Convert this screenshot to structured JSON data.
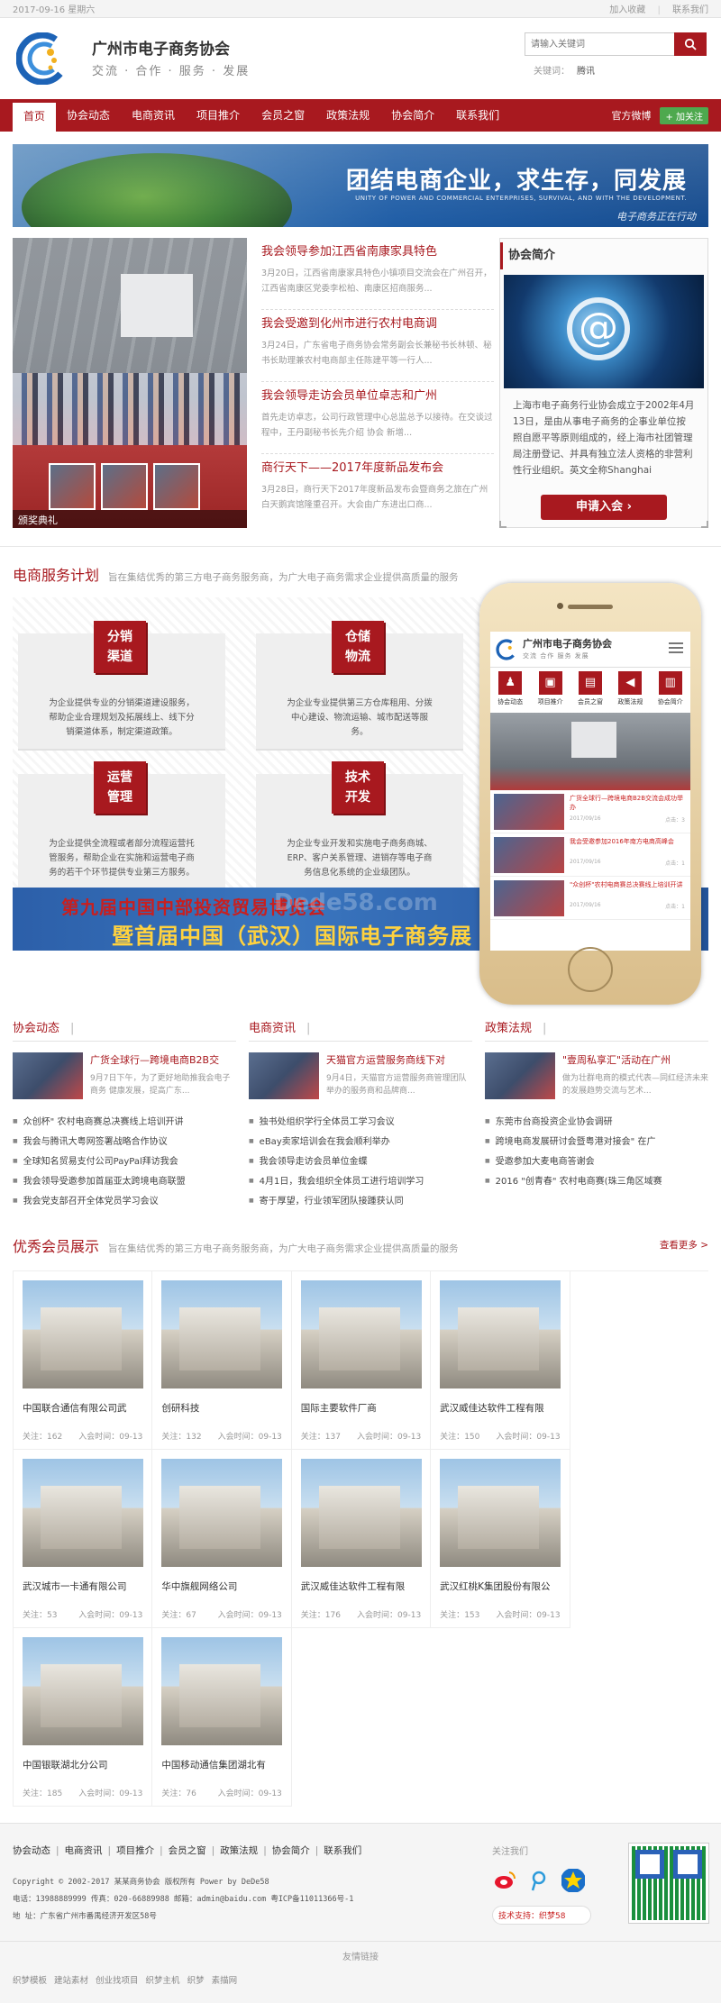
{
  "topbar": {
    "date": "2017-09-16 星期六",
    "favorite": "加入收藏",
    "contact": "联系我们"
  },
  "header": {
    "site_name": "广州市电子商务协会",
    "slogan": "交流 · 合作 · 服务 · 发展",
    "search_placeholder": "请输入关键词",
    "hot_label": "关键词：",
    "hot_word": "腾讯"
  },
  "nav": {
    "items": [
      "首页",
      "协会动态",
      "电商资讯",
      "项目推介",
      "会员之窗",
      "政策法规",
      "协会简介",
      "联系我们"
    ],
    "weibo": "官方微博",
    "follow": "+ 加关注"
  },
  "banner": {
    "title": "团结电商企业，求生存，同发展",
    "subtitle": "UNITY OF POWER AND COMMERCIAL ENTERPRISES, SURVIVAL, AND WITH THE DEVELOPMENT.",
    "tag": "电子商务正在行动"
  },
  "slide": {
    "caption": "颁奖典礼"
  },
  "news": [
    {
      "title": "我会领导参加江西省南康家具特色",
      "desc": "3月20日，江西省南康家具特色小镇项目交流会在广州召开，江西省南康区党委李松柏、南康区招商服务..."
    },
    {
      "title": "我会受邀到化州市进行农村电商调",
      "desc": "3月24日，广东省电子商务协会常务副会长兼秘书长林顿、秘书长助理兼农村电商部主任陈建平等一行人..."
    },
    {
      "title": "我会领导走访会员单位卓志和广州",
      "desc": "首先走访卓志，公司行政管理中心总监总予以接待。在交谈过程中，王丹副秘书长先介绍 协会 新增..."
    },
    {
      "title": "商行天下——2017年度新品发布会",
      "desc": "3月28日，商行天下2017年度新品发布会暨商务之旅在广州白天鹅宾馆隆重召开。大会由广东进出口商..."
    }
  ],
  "about": {
    "title": "协会简介",
    "text": "上海市电子商务行业协会成立于2002年4月13日，是由从事电子商务的企事业单位按照自愿平等原则组成的，经上海市社团管理局注册登记、并具有独立法人资格的非营利性行业组织。英文全称Shanghai Electronic Commerce A...",
    "join": "申请入会 ›"
  },
  "services": {
    "title": "电商服务计划",
    "subtitle": "旨在集结优秀的第三方电子商务服务商，为广大电子商务需求企业提供高质量的服务",
    "items": [
      {
        "badge1": "分销",
        "badge2": "渠道",
        "desc": "为企业提供专业的分销渠道建设服务，帮助企业合理规划及拓展线上、线下分销渠道体系，制定渠道政策。"
      },
      {
        "badge1": "仓储",
        "badge2": "物流",
        "desc": "为企业专业提供第三方仓库租用、分拨中心建设、物流运输、城市配送等服务。"
      },
      {
        "badge1": "运营",
        "badge2": "管理",
        "desc": "为企业提供全流程或者部分流程运营托管服务，帮助企业在实施和运营电子商务的若干个环节提供专业第三方服务。"
      },
      {
        "badge1": "技术",
        "badge2": "开发",
        "desc": "为企业专业开发和实施电子商务商城、ERP、客户关系管理、进销存等电子商务信息化系统的企业级团队。"
      }
    ]
  },
  "expo": {
    "line1": "第九届中国中部投资贸易博览会",
    "line2": "暨首届中国（武汉）国际电子商务展",
    "watermark": "Dede58.com"
  },
  "mobile": {
    "name": "广州市电子商务协会",
    "slogan": "交流 合作 服务 发展",
    "icons": [
      "协会动态",
      "项目推介",
      "会员之窗",
      "政策法规",
      "协会简介"
    ],
    "news": [
      {
        "title": "广货全球行—跨境电商B2B交流会成功举办",
        "date": "2017/09/16",
        "views": "点击：3"
      },
      {
        "title": "我会受邀参加2016年南方电商高峰会",
        "date": "2017/09/16",
        "views": "点击：1"
      },
      {
        "title": "\"众创杯\"农村电商赛总决赛线上培训开讲",
        "date": "2017/09/16",
        "views": "点击：1"
      }
    ]
  },
  "columns": [
    {
      "title": "协会动态",
      "feat_title": "广货全球行—跨境电商B2B交",
      "feat_desc": "9月7日下午，为了更好地助推我会电子商务 健康发展，提高广东...",
      "items": [
        "众创杯\" 农村电商赛总决赛线上培训开讲",
        "我会与腾讯大粤网签署战略合作协议",
        "全球知名贸易支付公司PayPal拜访我会",
        "我会领导受邀参加首届亚太跨境电商联盟",
        "我会党支部召开全体党员学习会议"
      ]
    },
    {
      "title": "电商资讯",
      "feat_title": "天猫官方运营服务商线下对",
      "feat_desc": "9月4日，天猫官方运营服务商管理团队举办的服务商和品牌商...",
      "items": [
        "独书处组织学行全体员工学习会议",
        "eBay卖家培训会在我会顺利举办",
        "我会领导走访会员单位金蝶",
        "4月1日，我会组织全体员工进行培训学习",
        "寄于厚望，行业领军团队接踵获认同"
      ]
    },
    {
      "title": "政策法规",
      "feat_title": "\"壹周私享汇\"活动在广州",
      "feat_desc": "做为壮群电商的模式代表—同红经济未来的发展趋势交流与艺术...",
      "items": [
        "东莞市台商投资企业协会调研",
        "跨境电商发展研讨会暨粤港对接会\" 在广",
        "受邀参加大麦电商答谢会",
        "2016 \"创青春\" 农村电商赛(珠三角区域赛",
        ""
      ]
    }
  ],
  "members": {
    "title": "优秀会员展示",
    "subtitle": "旨在集结优秀的第三方电子商务服务商，为广大电子商务需求企业提供高质量的服务",
    "more": "查看更多 >",
    "follow_label": "关注：",
    "join_label": "入会时间：",
    "items": [
      {
        "name": "中国联合通信有限公司武",
        "follows": "162",
        "date": "09-13"
      },
      {
        "name": "创研科技",
        "follows": "132",
        "date": "09-13"
      },
      {
        "name": "国际主要软件厂商",
        "follows": "137",
        "date": "09-13"
      },
      {
        "name": "武汉威佳达软件工程有限",
        "follows": "150",
        "date": "09-13"
      },
      {
        "name": "武汉城市一卡通有限公司",
        "follows": "53",
        "date": "09-13"
      },
      {
        "name": "华中旗舰网络公司",
        "follows": "67",
        "date": "09-13"
      },
      {
        "name": "武汉威佳达软件工程有限",
        "follows": "176",
        "date": "09-13"
      },
      {
        "name": "武汉红桃K集团股份有限公",
        "follows": "153",
        "date": "09-13"
      },
      {
        "name": "中国银联湖北分公司",
        "follows": "185",
        "date": "09-13"
      },
      {
        "name": "中国移动通信集团湖北有",
        "follows": "76",
        "date": "09-13"
      }
    ]
  },
  "footer": {
    "links": [
      "协会动态",
      "电商资讯",
      "项目推介",
      "会员之窗",
      "政策法规",
      "协会简介",
      "联系我们"
    ],
    "copyright": "Copyright © 2002-2017 某某商务协会 版权所有  Power by DeDe58",
    "phone": "电话：13988889999  传真：020-66889988  邮箱：admin@baidu.com 粤ICP备11011366号-1",
    "address": "地 址：广东省广州市番禺经济开发区58号",
    "follow_title": "关注我们",
    "tech": "技术支持：织梦58",
    "friend_title": "友情链接",
    "friend_links": [
      "织梦模板",
      "建站素材",
      "创业找项目",
      "织梦主机",
      "织梦",
      "素描网"
    ]
  }
}
